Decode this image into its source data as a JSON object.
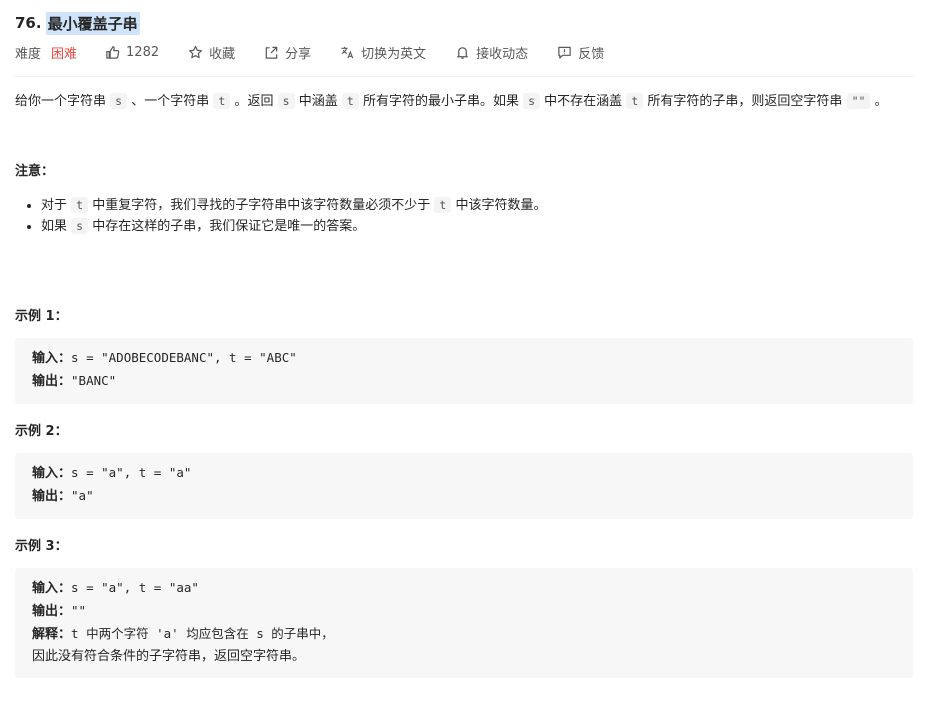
{
  "problem": {
    "number": "76.",
    "title": "最小覆盖子串"
  },
  "meta": {
    "difficulty_label": "难度",
    "difficulty": "困难",
    "likes": "1282",
    "favorite": "收藏",
    "share": "分享",
    "switch_lang": "切换为英文",
    "notify": "接收动态",
    "feedback": "反馈"
  },
  "description": {
    "p1": "给你一个字符串",
    "s": "s",
    "p2": "、一个字符串",
    "t": "t",
    "p3": "。返回",
    "p4": "中涵盖",
    "p5": "所有字符的最小子串。如果",
    "p6": "中不存在涵盖",
    "p7": "所有字符的子串，则返回空字符串",
    "empty": "\"\"",
    "p8": "。"
  },
  "notes": {
    "title": "注意：",
    "item1_a": "对于",
    "item1_b": "中重复字符，我们寻找的子字符串中该字符数量必须不少于",
    "item1_c": "中该字符数量。",
    "item2_a": "如果",
    "item2_b": "中存在这样的子串，我们保证它是唯一的答案。"
  },
  "examples": [
    {
      "title": "示例 1：",
      "input_label": "输入：",
      "input": "s = \"ADOBECODEBANC\", t = \"ABC\"",
      "output_label": "输出：",
      "output": "\"BANC\""
    },
    {
      "title": "示例 2：",
      "input_label": "输入：",
      "input": "s = \"a\", t = \"a\"",
      "output_label": "输出：",
      "output": "\"a\""
    },
    {
      "title": "示例 3：",
      "input_label": "输入：",
      "input": "s = \"a\", t = \"aa\"",
      "output_label": "输出：",
      "output": "\"\"",
      "explain_label": "解释：",
      "explain_1": "t 中两个字符 'a' 均应包含在 s 的子串中，",
      "explain_2": "因此没有符合条件的子字符串，返回空字符串。"
    }
  ],
  "colors": {
    "difficulty_hard": "#ef4743",
    "title_highlight": "#cfe4fb",
    "code_bg": "#f7f7f7"
  }
}
